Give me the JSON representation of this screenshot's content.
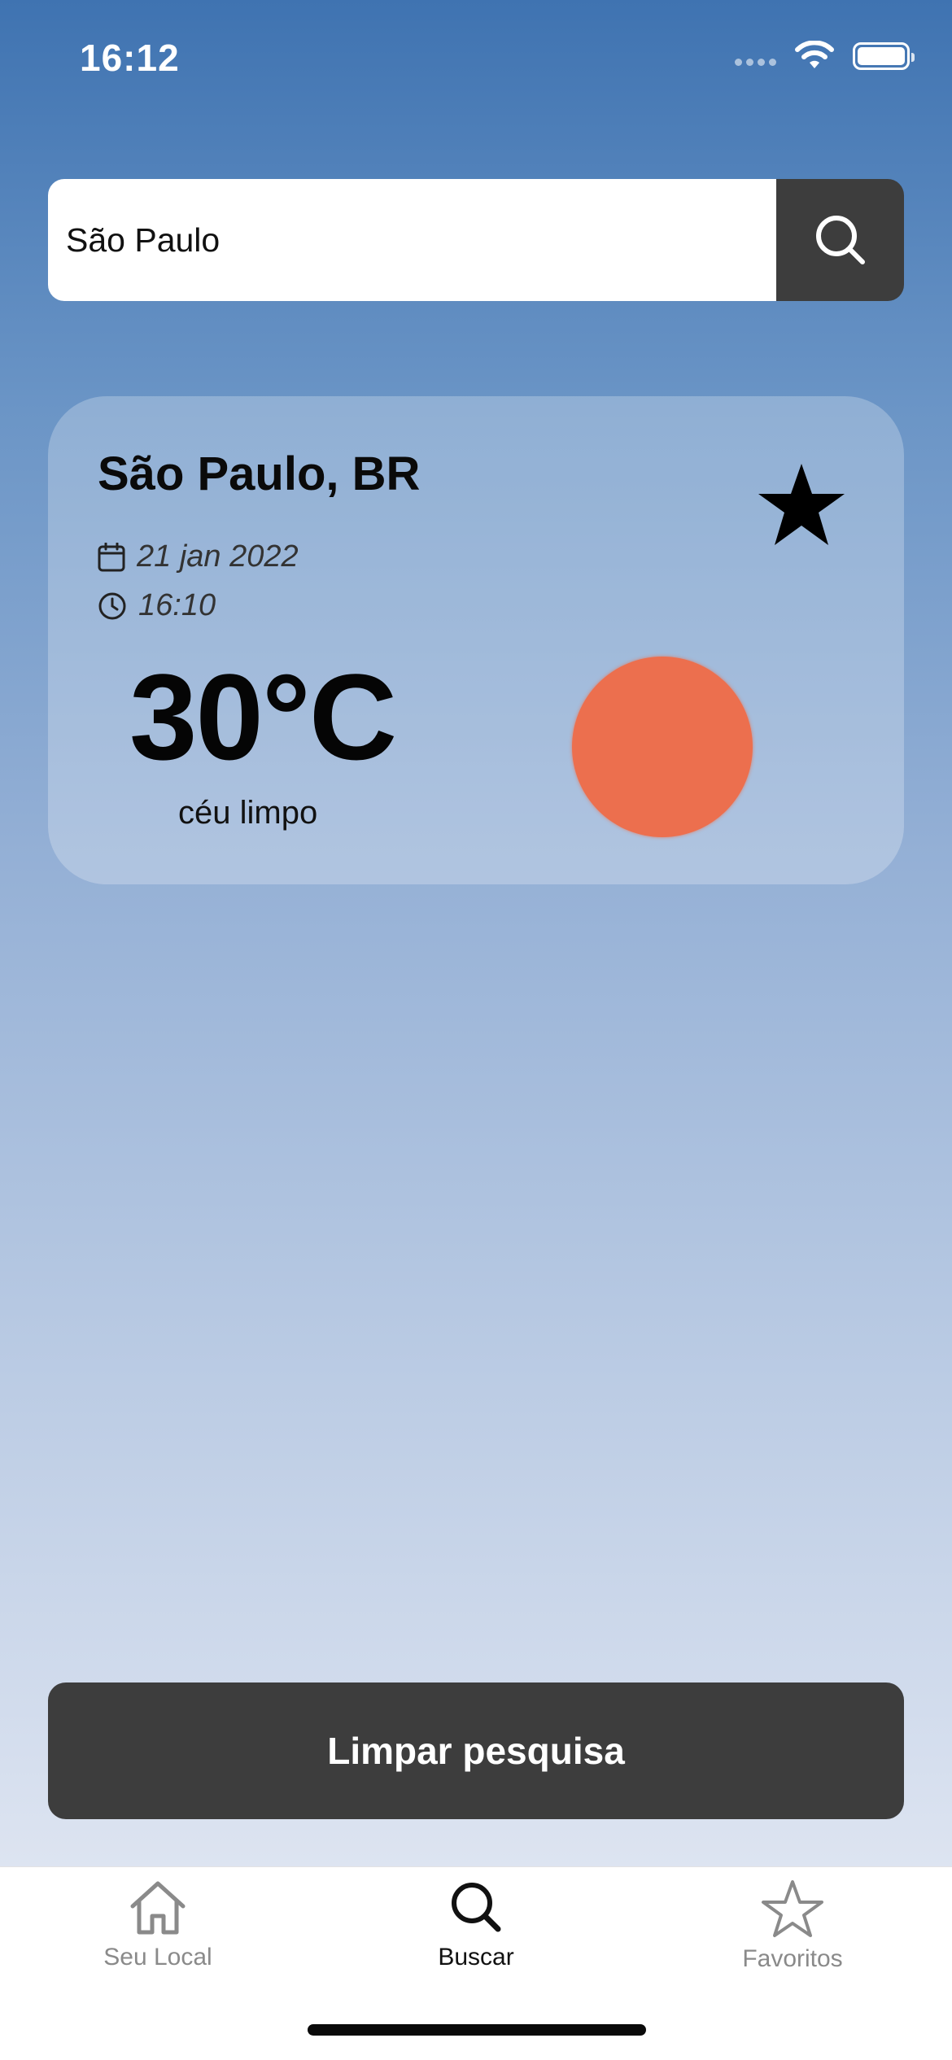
{
  "status_bar": {
    "time": "16:12"
  },
  "search": {
    "value": "São Paulo",
    "placeholder": ""
  },
  "weather_card": {
    "city": "São Paulo, BR",
    "date": "21 jan 2022",
    "time": "16:10",
    "temperature": "30°C",
    "condition": "céu limpo",
    "favorite": true,
    "sun_color": "#ec6f4e"
  },
  "actions": {
    "clear_label": "Limpar pesquisa"
  },
  "tab_bar": {
    "active": "Buscar",
    "tabs": [
      {
        "label": "Seu Local",
        "icon": "home-icon"
      },
      {
        "label": "Buscar",
        "icon": "search-icon"
      },
      {
        "label": "Favoritos",
        "icon": "star-outline-icon"
      }
    ]
  }
}
